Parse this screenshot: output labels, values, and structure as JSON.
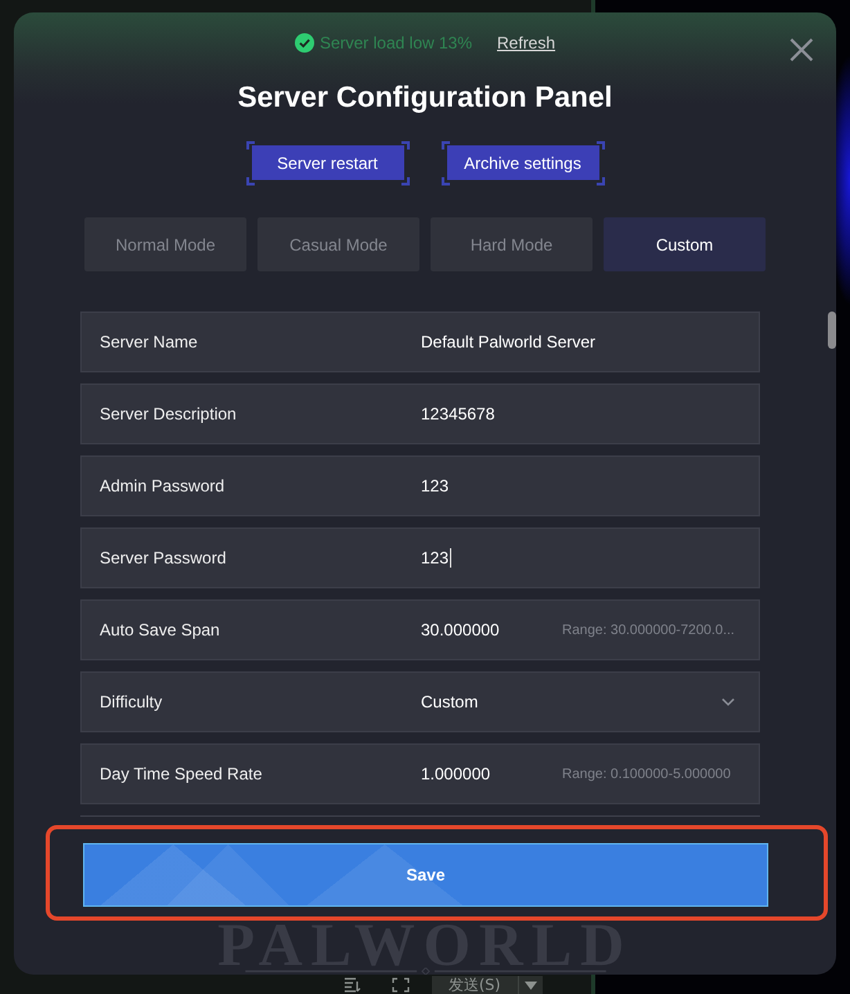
{
  "status": {
    "text": "Server load low 13%",
    "link": "Refresh"
  },
  "title": "Server Configuration Panel",
  "actions": [
    {
      "label": "Server restart"
    },
    {
      "label": "Archive settings"
    }
  ],
  "modes": [
    {
      "label": "Normal Mode",
      "selected": false
    },
    {
      "label": "Casual Mode",
      "selected": false
    },
    {
      "label": "Hard Mode",
      "selected": false
    },
    {
      "label": "Custom",
      "selected": true
    }
  ],
  "settings": [
    {
      "kind": "text",
      "label": "Server Name",
      "value": "Default Palworld Server",
      "focused": false
    },
    {
      "kind": "text",
      "label": "Server Description",
      "value": "12345678",
      "focused": false
    },
    {
      "kind": "text",
      "label": "Admin Password",
      "value": "123",
      "focused": false
    },
    {
      "kind": "text",
      "label": "Server Password",
      "value": "123",
      "focused": true
    },
    {
      "kind": "number",
      "label": "Auto Save Span",
      "value": "30.000000",
      "hint": "Range: 30.000000-7200.0...",
      "focused": false
    },
    {
      "kind": "select",
      "label": "Difficulty",
      "value": "Custom",
      "focused": false
    },
    {
      "kind": "number",
      "label": "Day Time Speed Rate",
      "value": "1.000000",
      "hint": "Range: 0.100000-5.000000",
      "focused": false
    }
  ],
  "save": {
    "label": "Save",
    "highlighted": true
  },
  "logo": "PALWORLD",
  "background_app": {
    "send_button": "发送(S)"
  }
}
